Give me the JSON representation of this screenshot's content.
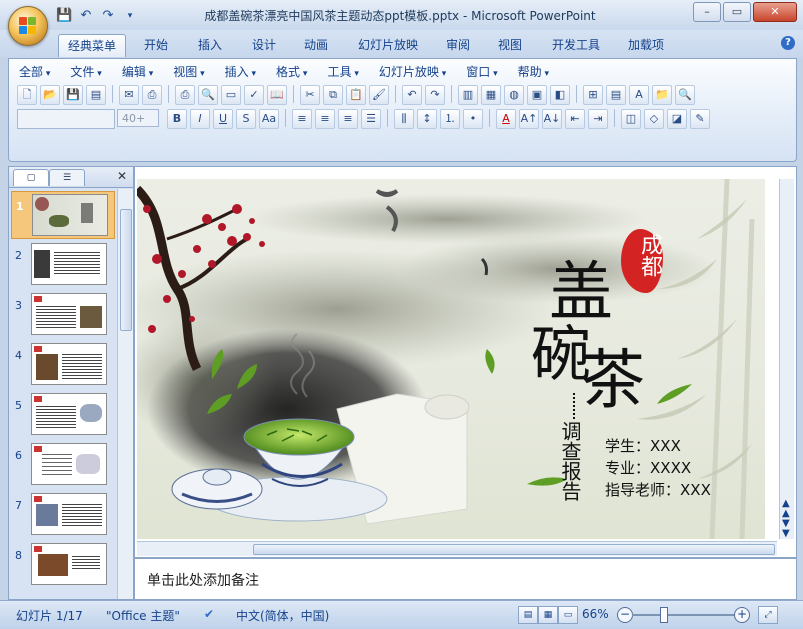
{
  "window": {
    "title": "成都盖碗茶漂亮中国风茶主题动态ppt模板.pptx - Microsoft PowerPoint",
    "controls": [
      "–",
      "▭",
      "✕"
    ]
  },
  "ribbon_tabs": [
    {
      "label": "经典菜单",
      "active": true
    },
    {
      "label": "开始"
    },
    {
      "label": "插入"
    },
    {
      "label": "设计"
    },
    {
      "label": "动画"
    },
    {
      "label": "幻灯片放映"
    },
    {
      "label": "审阅"
    },
    {
      "label": "视图"
    },
    {
      "label": "开发工具"
    },
    {
      "label": "加载项"
    }
  ],
  "classic_menu": [
    "全部",
    "文件",
    "编辑",
    "视图",
    "插入",
    "格式",
    "工具",
    "幻灯片放映",
    "窗口",
    "帮助"
  ],
  "font_size_placeholder": "40+",
  "slides_panel": {
    "tab1_label": "▢",
    "tab2_label": "☰",
    "close": "✕",
    "numbers": [
      "1",
      "2",
      "3",
      "4",
      "5",
      "6",
      "7",
      "8"
    ]
  },
  "slide": {
    "badge": "成都",
    "title_lines": [
      "盖",
      "碗",
      "茶"
    ],
    "subtitle": "调查报告",
    "info": [
      {
        "label": "学生",
        "value": "XXX"
      },
      {
        "label": "专业",
        "value": "XXXX"
      },
      {
        "label": "指导老师",
        "value": "XXX"
      }
    ]
  },
  "notes_placeholder": "单击此处添加备注",
  "status": {
    "slide_counter": "幻灯片 1/17",
    "theme": "\"Office 主题\"",
    "language": "中文(简体，中国)",
    "zoom": "66%"
  },
  "colors": {
    "badge_red": "#d42323",
    "selected_thumb": "#f5c77d",
    "ribbon_bg": "#dbe6f4"
  }
}
